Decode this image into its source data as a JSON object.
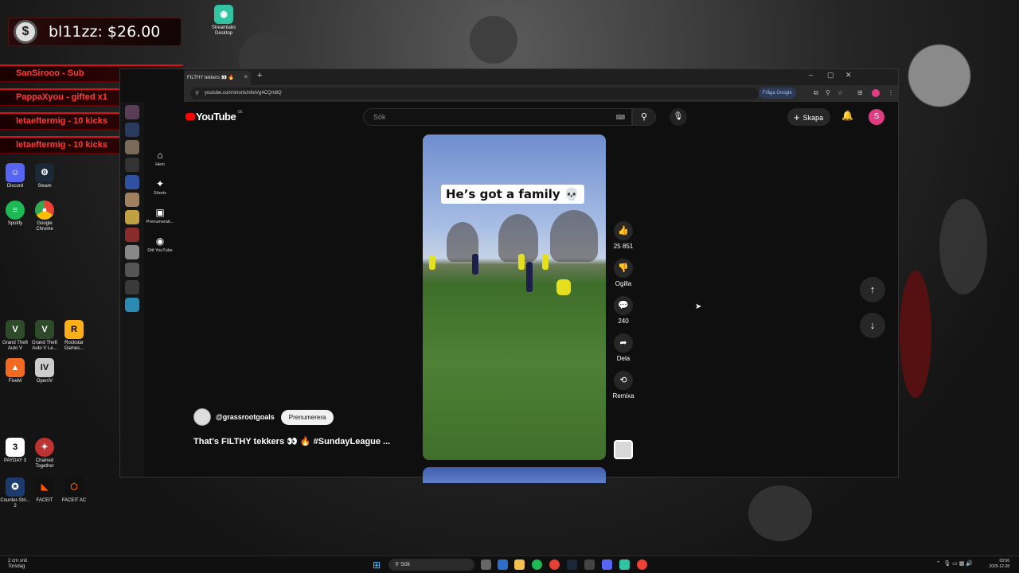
{
  "overlay": {
    "coin_label": "bl11zz: $26.00",
    "alerts": [
      "SanSirooo - Sub",
      "PappaXyou - gifted x1",
      "letaeftermig - 10 kicks",
      "letaeftermig - 10 kicks"
    ]
  },
  "desktop_icons": {
    "top": [
      "Streamlabs Desktop"
    ],
    "discord": "Discord",
    "steam": "Steam",
    "spotify": "Spotify",
    "chrome": "Google Chrome",
    "gta1": "Grand Theft Auto V",
    "gta2": "Grand Theft Auto V Le...",
    "rockstar": "Rockstar Games...",
    "fivem": "FiveM",
    "openiv": "OpenIV",
    "payday": "PAYDAY 3",
    "chained": "Chained Together",
    "cs": "Counter-Stri... 2",
    "faceit": "FACEIT",
    "faceitac": "FACEIT AC"
  },
  "browser": {
    "tab_title": "FILTHY tekkers 👀 🔥",
    "url": "youtube.com/shorts/n6oVg4CQm8Q",
    "google_button": "Fråga Google"
  },
  "youtube": {
    "logo": "YouTube",
    "region": "SE",
    "search_placeholder": "Sök",
    "create_label": "Skapa",
    "avatar_letter": "S",
    "nav": [
      {
        "icon": "⌂",
        "label": "Hem"
      },
      {
        "icon": "✦",
        "label": "Shorts"
      },
      {
        "icon": "▣",
        "label": "Prenumerati..."
      },
      {
        "icon": "◉",
        "label": "Ditt YouTube"
      }
    ],
    "video_caption": "He’s got a family 💀",
    "channel": "@grassrootgoals",
    "subscribe": "Prenumerera",
    "title": "That's FILTHY tekkers 👀 🔥 #SundayLeague ...",
    "actions": {
      "like_count": "25 851",
      "dislike": "Ogilla",
      "comments": "240",
      "share": "Dela",
      "remix": "Remixa"
    }
  },
  "taskbar": {
    "weather": "2 cm snö",
    "weather_sub": "Torsdag",
    "search": "Sök",
    "time": "03:56",
    "date": "2025-12-28"
  }
}
